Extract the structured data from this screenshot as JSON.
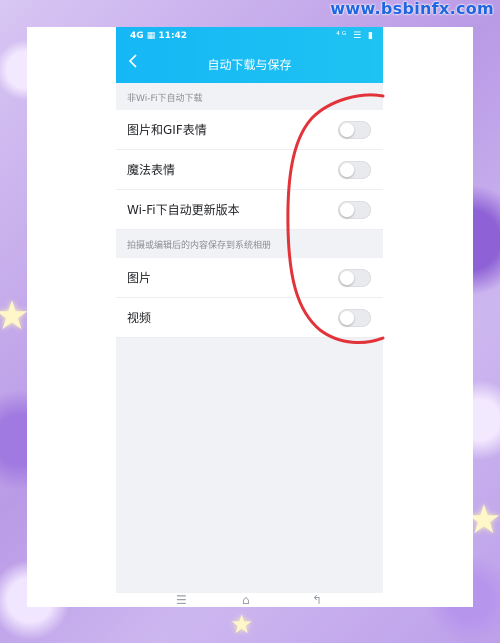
{
  "watermark": "www.bsbinfx.com",
  "status_bar": {
    "left": "4G ▦ 11:42",
    "right": "⁴ᴳ ☰ ▮"
  },
  "header": {
    "back_icon": "chevron-left-icon",
    "title": "自动下载与保存"
  },
  "sections": [
    {
      "header": "非Wi-Fi下自动下载",
      "items": [
        {
          "label": "图片和GIF表情",
          "toggle": false
        },
        {
          "label": "魔法表情",
          "toggle": false
        },
        {
          "label": "Wi-Fi下自动更新版本",
          "toggle": false
        }
      ]
    },
    {
      "header": "拍摄或编辑后的内容保存到系统相册",
      "items": [
        {
          "label": "图片",
          "toggle": false
        },
        {
          "label": "视频",
          "toggle": false
        }
      ]
    }
  ],
  "nav_bar": {
    "menu_icon": "menu-icon",
    "home_icon": "home-icon",
    "back_icon": "back-icon",
    "menu_glyph": "☰",
    "home_glyph": "⌂",
    "back_glyph": "↰"
  },
  "colors": {
    "header_blue": "#1fbdf4",
    "annotation_red": "#e2333a"
  }
}
